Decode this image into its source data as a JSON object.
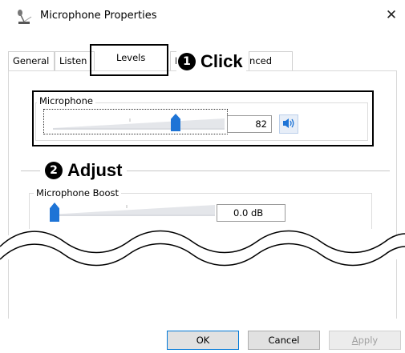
{
  "window": {
    "title": "Microphone Properties",
    "close_glyph": "✕",
    "icon": "microphone-icon"
  },
  "tabs": [
    {
      "label": "General"
    },
    {
      "label": "Listen"
    },
    {
      "label": "Levels"
    },
    {
      "label": "E"
    },
    {
      "label": "anced"
    }
  ],
  "annotations": {
    "step1_number": "1",
    "step1_text": "Click",
    "step2_number": "2",
    "step2_text": "Adjust"
  },
  "levels": {
    "microphone": {
      "label": "Microphone",
      "value": "82",
      "slider_fraction": 0.82
    },
    "boost": {
      "label": "Microphone Boost",
      "value": "0.0 dB",
      "slider_fraction": 0.0
    }
  },
  "buttons": {
    "ok": "OK",
    "cancel": "Cancel",
    "apply_first": "A",
    "apply_rest": "pply"
  },
  "colors": {
    "accent": "#1e74d6",
    "focus_border": "#0078d7"
  }
}
